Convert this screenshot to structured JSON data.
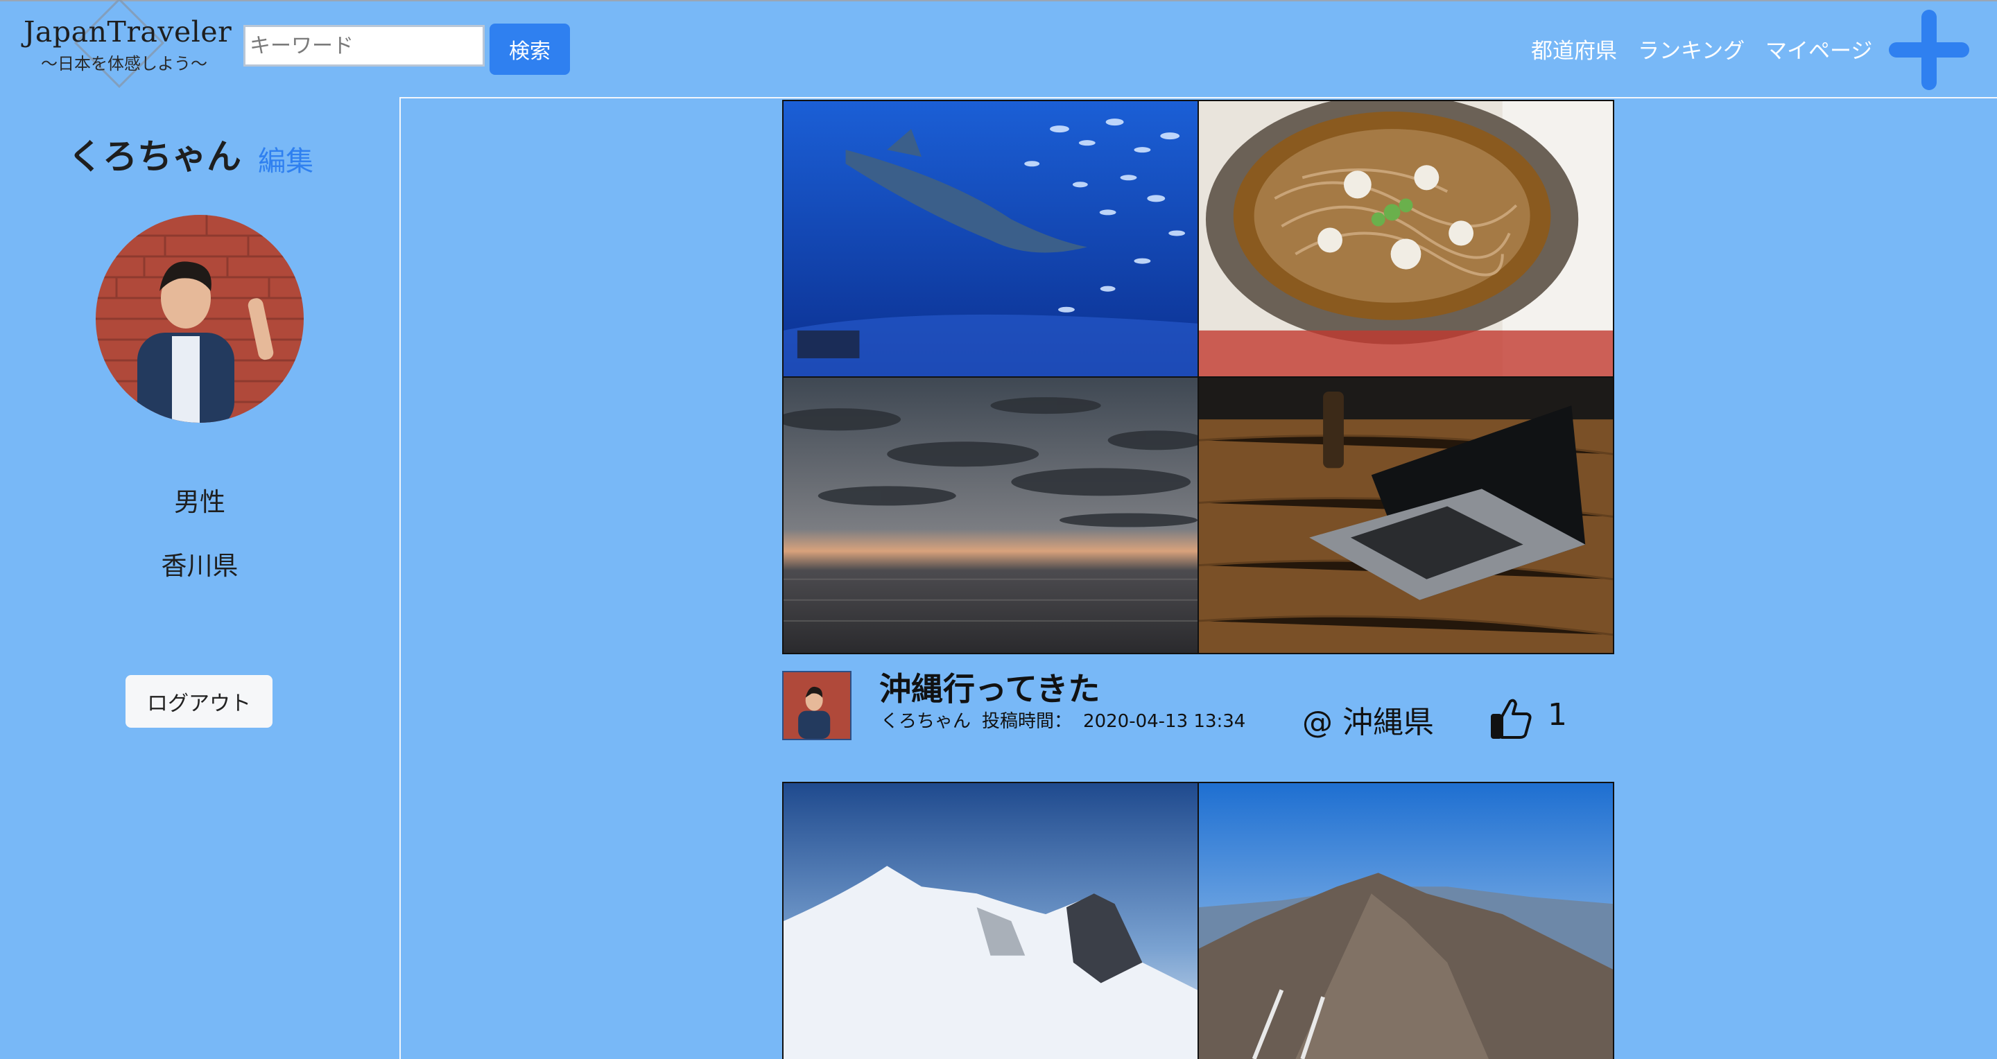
{
  "header": {
    "logo_title": "JapanTraveler",
    "logo_subtitle": "〜日本を体感しよう〜",
    "search_placeholder": "キーワード",
    "search_button": "検索",
    "nav": [
      "都道府県",
      "ランキング",
      "マイページ"
    ],
    "plus_icon": "plus-icon"
  },
  "profile": {
    "name": "くろちゃん",
    "edit_label": "編集",
    "gender": "男性",
    "prefecture": "香川県",
    "logout_label": "ログアウト"
  },
  "posts": [
    {
      "title": "沖縄行ってきた",
      "author": "くろちゃん",
      "time_label": "投稿時間：",
      "time": "2020-04-13 13:34",
      "location": "@ 沖縄県",
      "likes": "1",
      "photos": [
        "whale-shark-aquarium",
        "soba-bowl",
        "sunset-sea",
        "laptop-on-table"
      ]
    },
    {
      "photos": [
        "snowy-mountain",
        "rocky-mountain-ridge"
      ]
    }
  ],
  "colors": {
    "background": "#78b8f7",
    "accent": "#2f80f0"
  }
}
